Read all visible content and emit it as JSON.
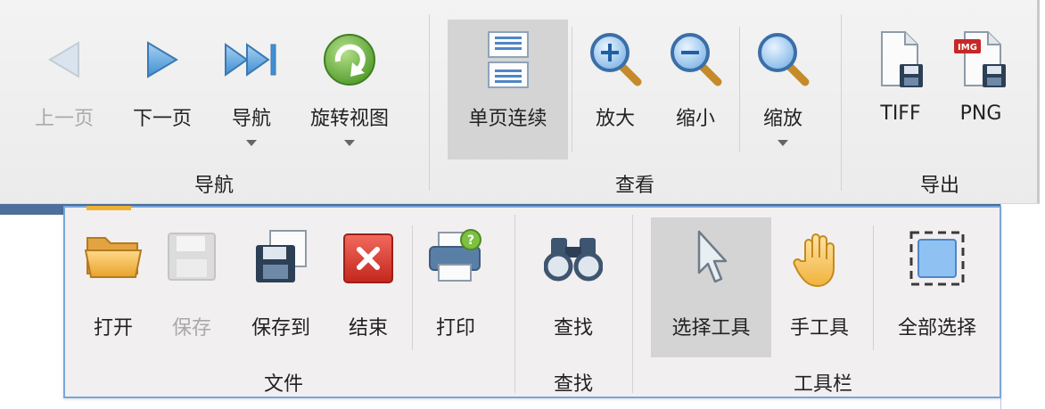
{
  "ribbon": {
    "navigation": {
      "group_label": "导航",
      "prev_label": "上一页",
      "next_label": "下一页",
      "nav_label": "导航",
      "rotate_label": "旋转视图"
    },
    "view": {
      "group_label": "查看",
      "single_continuous_label": "单页连续",
      "zoom_in_label": "放大",
      "zoom_out_label": "缩小",
      "zoom_label": "缩放"
    },
    "export": {
      "group_label": "导出",
      "tiff_label": "TIFF",
      "png_label": "PNG",
      "img_badge": "IMG"
    }
  },
  "toolbar": {
    "file": {
      "group_label": "文件",
      "open_label": "打开",
      "save_label": "保存",
      "save_to_label": "保存到",
      "end_label": "结束",
      "print_label": "打印"
    },
    "find": {
      "group_label": "查找",
      "find_label": "查找"
    },
    "tools": {
      "group_label": "工具栏",
      "select_label": "选择工具",
      "hand_label": "手工具",
      "select_all_label": "全部选择"
    }
  },
  "colors": {
    "accent_blue": "#78a6dd",
    "selected_bg": "#d4d4d4",
    "close_red": "#d9342b",
    "rotate_green": "#6cb33e"
  },
  "icons": [
    "triangle-left-icon",
    "triangle-right-icon",
    "skip-forward-icon",
    "rotate-icon",
    "page-stack-icon",
    "zoom-in-icon",
    "zoom-out-icon",
    "magnifier-icon",
    "tiff-file-icon",
    "png-file-icon",
    "folder-icon",
    "floppy-icon",
    "save-to-icon",
    "close-icon",
    "printer-icon",
    "binoculars-icon",
    "cursor-icon",
    "hand-icon",
    "select-all-icon"
  ]
}
